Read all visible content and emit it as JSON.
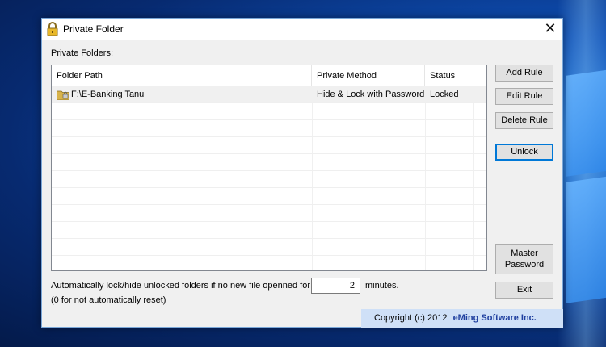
{
  "window": {
    "title": "Private Folder",
    "close_glyph": "✕"
  },
  "private_folders_label": "Private Folders:",
  "list": {
    "columns": [
      "Folder Path",
      "Private Method",
      "Status"
    ],
    "rows": [
      {
        "path": "F:\\E-Banking Tanu",
        "method": "Hide & Lock with Password",
        "status": "Locked",
        "icon": "locked-folder-icon"
      }
    ]
  },
  "buttons": {
    "add_rule": "Add Rule",
    "edit_rule": "Edit Rule",
    "delete_rule": "Delete Rule",
    "unlock": "Unlock",
    "master_password_line1": "Master",
    "master_password_line2": "Password",
    "exit": "Exit"
  },
  "auto_lock": {
    "text": "Automatically lock/hide unlocked folders if no new file openned for",
    "value": "2",
    "unit": "minutes.",
    "note": "(0 for not automatically reset)"
  },
  "footer": {
    "copyright": "Copyright (c) 2012",
    "company": "eMing Software Inc."
  },
  "colors": {
    "window_bg": "#f0f0f0",
    "footer_bg": "#cfe0f7",
    "company_text": "#1f3f9f",
    "focus_blue": "#0078d7"
  }
}
